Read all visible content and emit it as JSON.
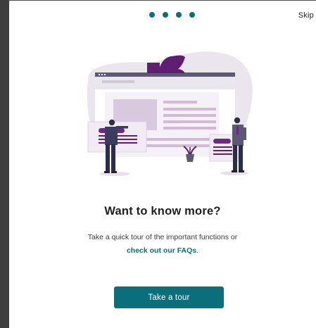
{
  "onboarding": {
    "step_indicator": {
      "total": 4,
      "active_color": "#0b6f7b"
    },
    "skip_label": "Skip",
    "headline": "Want to know more?",
    "description_line1": "Take a quick tour of the important functions or",
    "faq_link_text": "check out our FAQs",
    "description_end": ".",
    "tour_button_label": "Take a tour"
  },
  "colors": {
    "accent": "#0b6f7b",
    "illustration_purple": "#5e1e72",
    "illustration_lavender": "#e4dce8"
  }
}
